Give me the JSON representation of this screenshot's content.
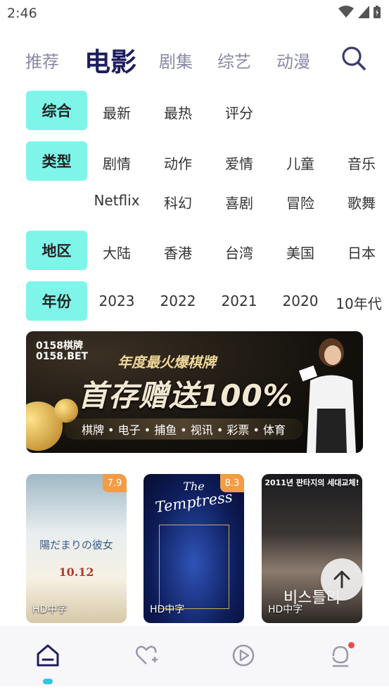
{
  "status_bar": {
    "time": "2:46"
  },
  "top_nav": {
    "tabs": [
      {
        "label": "推荐",
        "active": false
      },
      {
        "label": "电影",
        "active": true
      },
      {
        "label": "剧集",
        "active": false
      },
      {
        "label": "综艺",
        "active": false
      },
      {
        "label": "动漫",
        "active": false
      }
    ],
    "search_icon": "search-icon"
  },
  "filters": {
    "sort": {
      "label": "综合",
      "options": [
        "最新",
        "最热",
        "评分"
      ]
    },
    "genre": {
      "label": "类型",
      "options_row1": [
        "剧情",
        "动作",
        "爱情",
        "儿童",
        "音乐"
      ],
      "options_row2": [
        "Netflix",
        "科幻",
        "喜剧",
        "冒险",
        "歌舞"
      ]
    },
    "region": {
      "label": "地区",
      "options": [
        "大陆",
        "香港",
        "台湾",
        "美国",
        "日本"
      ]
    },
    "year": {
      "label": "年份",
      "options": [
        "2023",
        "2022",
        "2021",
        "2020",
        "10年代"
      ]
    }
  },
  "banner": {
    "logo_line1": "0158棋牌",
    "logo_line2": "0158.BET",
    "headline": "年度最火爆棋牌",
    "big_text": "首存赠送100%",
    "categories": "棋牌 • 电子 • 捕鱼 • 视讯 • 彩票 • 体育"
  },
  "movies": [
    {
      "rating": "7.9",
      "quality": "HD中字",
      "poster_title": "陽だまりの彼女",
      "poster_date": "10.12"
    },
    {
      "rating": "8.3",
      "quality": "HD中字",
      "poster_title": "Temptress",
      "poster_prefix": "The"
    },
    {
      "rating": "",
      "quality": "HD中字",
      "poster_header": "2011년 판타지의 세대교체!",
      "poster_title": "비스틀리"
    }
  ],
  "bottom_nav": {
    "items": [
      "home-icon",
      "favorite-add-icon",
      "play-icon",
      "profile-icon"
    ],
    "active": "home-icon"
  },
  "colors": {
    "accent": "#7ff5ea",
    "nav_active": "#1d1d5e",
    "rating_badge": "#f39c46",
    "indicator": "#2ec8e0"
  }
}
